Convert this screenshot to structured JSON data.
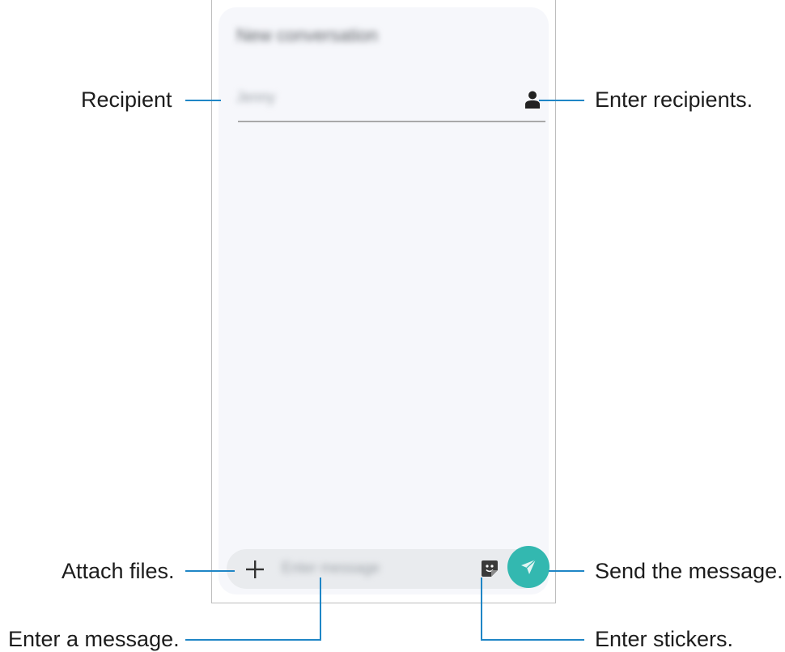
{
  "screen": {
    "title": "New conversation",
    "recipient_field_value": "Jenny",
    "message_placeholder": "Enter message"
  },
  "callouts": {
    "recipient": "Recipient",
    "enter_recipients": "Enter recipients.",
    "attach_files": "Attach files.",
    "send_message": "Send the message.",
    "enter_message": "Enter a message.",
    "enter_stickers": "Enter stickers."
  },
  "colors": {
    "callout_line": "#1f86c6",
    "send_button": "#33b8b0"
  },
  "icons": {
    "contact": "person-icon",
    "attach": "plus-icon",
    "sticker": "sticker-icon",
    "send": "send-icon"
  }
}
